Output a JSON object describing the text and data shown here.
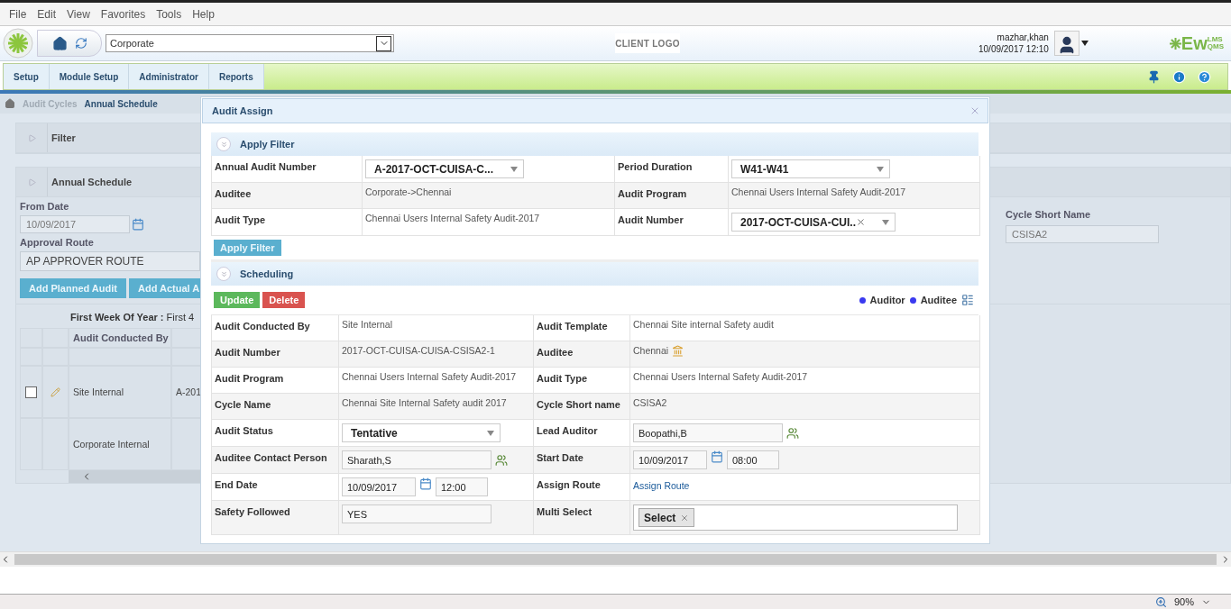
{
  "menu_bar": [
    "File",
    "Edit",
    "View",
    "Favorites",
    "Tools",
    "Help"
  ],
  "header": {
    "site_select": "Corporate",
    "client_logo": "CLIENT LOGO",
    "user_name": "mazhar,khan",
    "datetime": "10/09/2017 12:10",
    "brand": {
      "main": "Ew",
      "top": "LMS",
      "bottom": "QMS"
    }
  },
  "nav_tabs": [
    "Setup",
    "Module Setup",
    "Administrator",
    "Reports"
  ],
  "breadcrumb": [
    {
      "label": "Audit Cycles",
      "current": false
    },
    {
      "label": "Annual Schedule",
      "current": true
    }
  ],
  "background": {
    "panels": [
      "Filter",
      "Annual Schedule"
    ],
    "from_date": {
      "label": "From Date",
      "value": "10/09/2017"
    },
    "cycle_short_name": {
      "label": "Cycle Short Name",
      "value": "CSISA2"
    },
    "approval_route": {
      "label": "Approval Route",
      "value": "AP APPROVER ROUTE"
    },
    "buttons": [
      "Add Planned Audit",
      "Add Actual A"
    ],
    "first_week": {
      "label": "First Week Of Year :",
      "value": "First 4"
    },
    "table": {
      "columns": [
        "Audit Conducted By"
      ],
      "rows": [
        {
          "kind": "entry",
          "checked": false,
          "cells": [
            "Site Internal",
            "A-201"
          ]
        },
        {
          "kind": "group",
          "cells": [
            "Corporate Internal"
          ]
        }
      ]
    }
  },
  "modal": {
    "title": "Audit Assign",
    "filter": {
      "title": "Apply Filter",
      "button": "Apply Filter",
      "fields": [
        {
          "label": "Annual Audit Number",
          "kind": "select",
          "value": "A-2017-OCT-CUISA-C..."
        },
        {
          "label": "Period Duration",
          "kind": "select",
          "value": "W41-W41"
        },
        {
          "label": "Auditee",
          "kind": "text",
          "value": "Corporate->Chennai"
        },
        {
          "label": "Audit Program",
          "kind": "text",
          "value": "Chennai Users Internal Safety Audit-2017"
        },
        {
          "label": "Audit Type",
          "kind": "text",
          "value": "Chennai Users Internal Safety Audit-2017"
        },
        {
          "label": "Audit Number",
          "kind": "select",
          "value": "2017-OCT-CUISA-CUI..",
          "clearable": true
        }
      ]
    },
    "scheduling": {
      "title": "Scheduling",
      "actions": [
        {
          "label": "Update",
          "kind": "update"
        },
        {
          "label": "Delete",
          "kind": "delete"
        }
      ],
      "legend": [
        {
          "label": "Auditor",
          "color": "#3a3af0"
        },
        {
          "label": "Auditee",
          "color": "#3a3af0"
        }
      ],
      "fields": [
        {
          "label": "Audit Conducted By",
          "kind": "text",
          "value": "Site Internal"
        },
        {
          "label": "Audit Template",
          "kind": "text",
          "value": "Chennai Site internal Safety audit"
        },
        {
          "label": "Audit Number",
          "kind": "text",
          "value": "2017-OCT-CUISA-CUISA-CSISA2-1"
        },
        {
          "label": "Auditee",
          "kind": "place",
          "value": "Chennai"
        },
        {
          "label": "Audit Program",
          "kind": "text",
          "value": "Chennai Users Internal Safety Audit-2017"
        },
        {
          "label": "Audit Type",
          "kind": "text",
          "value": "Chennai Users Internal Safety Audit-2017"
        },
        {
          "label": "Cycle Name",
          "kind": "text",
          "value": "Chennai Site Internal Safety audit 2017"
        },
        {
          "label": "Cycle Short name",
          "kind": "text",
          "value": "CSISA2"
        },
        {
          "label": "Audit Status",
          "kind": "select",
          "value": "Tentative"
        },
        {
          "label": "Lead Auditor",
          "kind": "person",
          "value": "Boopathi,B"
        },
        {
          "label": "Auditee Contact Person",
          "kind": "person",
          "value": "Sharath,S"
        },
        {
          "label": "Start Date",
          "kind": "datetime",
          "value": "10/09/2017",
          "time": "08:00"
        },
        {
          "label": "End Date",
          "kind": "datetime",
          "value": "10/09/2017",
          "time": "12:00"
        },
        {
          "label": "Assign Route",
          "kind": "link",
          "value": "Assign Route"
        },
        {
          "label": "Safety Followed",
          "kind": "input",
          "value": "YES"
        },
        {
          "label": "Multi Select",
          "kind": "tags",
          "tags": [
            "Select"
          ]
        }
      ]
    }
  },
  "status_bar": {
    "zoom": "90%"
  }
}
